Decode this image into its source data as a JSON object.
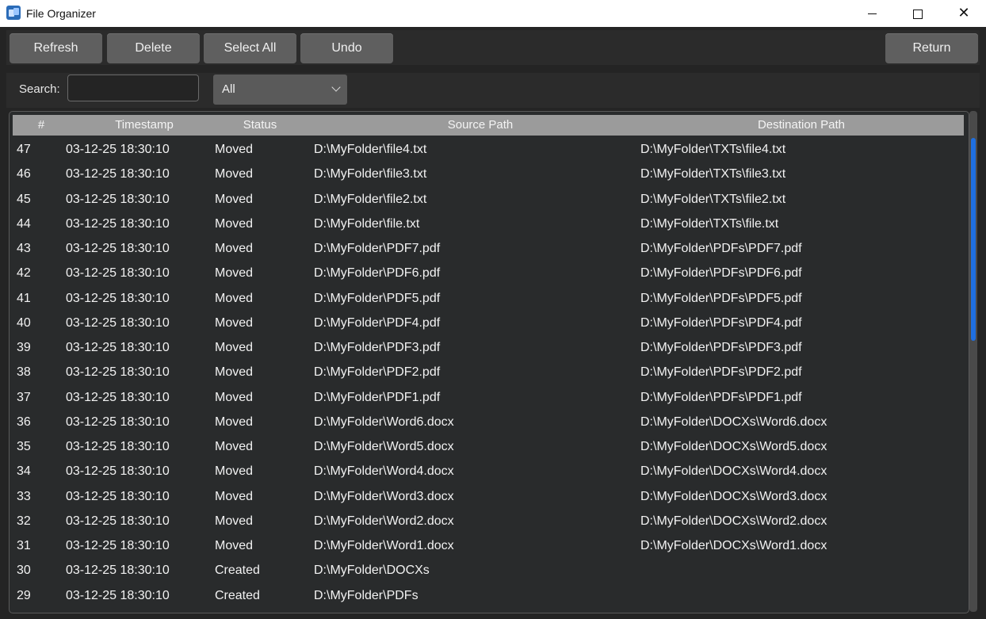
{
  "window": {
    "title": "File Organizer",
    "controls": {
      "minimize": "minimize-icon",
      "maximize": "maximize-icon",
      "close": "close-icon"
    }
  },
  "toolbar": {
    "refresh_label": "Refresh",
    "delete_label": "Delete",
    "select_all_label": "Select All",
    "undo_label": "Undo",
    "return_label": "Return"
  },
  "filter": {
    "search_label": "Search:",
    "search_value": "",
    "status_selected": "All"
  },
  "table": {
    "columns": [
      "#",
      "Timestamp",
      "Status",
      "Source Path",
      "Destination Path"
    ],
    "rows": [
      [
        "47",
        "03-12-25 18:30:10",
        "Moved",
        "D:\\MyFolder\\file4.txt",
        "D:\\MyFolder\\TXTs\\file4.txt"
      ],
      [
        "46",
        "03-12-25 18:30:10",
        "Moved",
        "D:\\MyFolder\\file3.txt",
        "D:\\MyFolder\\TXTs\\file3.txt"
      ],
      [
        "45",
        "03-12-25 18:30:10",
        "Moved",
        "D:\\MyFolder\\file2.txt",
        "D:\\MyFolder\\TXTs\\file2.txt"
      ],
      [
        "44",
        "03-12-25 18:30:10",
        "Moved",
        "D:\\MyFolder\\file.txt",
        "D:\\MyFolder\\TXTs\\file.txt"
      ],
      [
        "43",
        "03-12-25 18:30:10",
        "Moved",
        "D:\\MyFolder\\PDF7.pdf",
        "D:\\MyFolder\\PDFs\\PDF7.pdf"
      ],
      [
        "42",
        "03-12-25 18:30:10",
        "Moved",
        "D:\\MyFolder\\PDF6.pdf",
        "D:\\MyFolder\\PDFs\\PDF6.pdf"
      ],
      [
        "41",
        "03-12-25 18:30:10",
        "Moved",
        "D:\\MyFolder\\PDF5.pdf",
        "D:\\MyFolder\\PDFs\\PDF5.pdf"
      ],
      [
        "40",
        "03-12-25 18:30:10",
        "Moved",
        "D:\\MyFolder\\PDF4.pdf",
        "D:\\MyFolder\\PDFs\\PDF4.pdf"
      ],
      [
        "39",
        "03-12-25 18:30:10",
        "Moved",
        "D:\\MyFolder\\PDF3.pdf",
        "D:\\MyFolder\\PDFs\\PDF3.pdf"
      ],
      [
        "38",
        "03-12-25 18:30:10",
        "Moved",
        "D:\\MyFolder\\PDF2.pdf",
        "D:\\MyFolder\\PDFs\\PDF2.pdf"
      ],
      [
        "37",
        "03-12-25 18:30:10",
        "Moved",
        "D:\\MyFolder\\PDF1.pdf",
        "D:\\MyFolder\\PDFs\\PDF1.pdf"
      ],
      [
        "36",
        "03-12-25 18:30:10",
        "Moved",
        "D:\\MyFolder\\Word6.docx",
        "D:\\MyFolder\\DOCXs\\Word6.docx"
      ],
      [
        "35",
        "03-12-25 18:30:10",
        "Moved",
        "D:\\MyFolder\\Word5.docx",
        "D:\\MyFolder\\DOCXs\\Word5.docx"
      ],
      [
        "34",
        "03-12-25 18:30:10",
        "Moved",
        "D:\\MyFolder\\Word4.docx",
        "D:\\MyFolder\\DOCXs\\Word4.docx"
      ],
      [
        "33",
        "03-12-25 18:30:10",
        "Moved",
        "D:\\MyFolder\\Word3.docx",
        "D:\\MyFolder\\DOCXs\\Word3.docx"
      ],
      [
        "32",
        "03-12-25 18:30:10",
        "Moved",
        "D:\\MyFolder\\Word2.docx",
        "D:\\MyFolder\\DOCXs\\Word2.docx"
      ],
      [
        "31",
        "03-12-25 18:30:10",
        "Moved",
        "D:\\MyFolder\\Word1.docx",
        "D:\\MyFolder\\DOCXs\\Word1.docx"
      ],
      [
        "30",
        "03-12-25 18:30:10",
        "Created",
        "D:\\MyFolder\\DOCXs",
        ""
      ],
      [
        "29",
        "03-12-25 18:30:10",
        "Created",
        "D:\\MyFolder\\PDFs",
        ""
      ]
    ]
  },
  "scrollbar": {
    "thumb_color": "#1f6fe0"
  }
}
